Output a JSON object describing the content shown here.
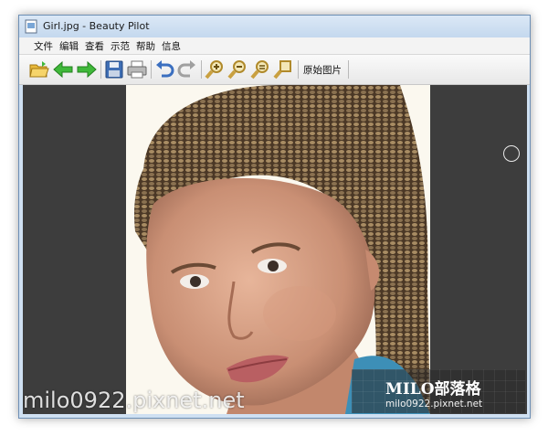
{
  "window": {
    "title": "Girl.jpg - Beauty Pilot"
  },
  "menu": {
    "items": [
      {
        "label": "文件"
      },
      {
        "label": "编辑"
      },
      {
        "label": "查看"
      },
      {
        "label": "示范"
      },
      {
        "label": "帮助"
      },
      {
        "label": "信息"
      }
    ]
  },
  "toolbar": {
    "buttons": [
      {
        "icon": "open-folder-icon"
      },
      {
        "icon": "back-arrow-icon"
      },
      {
        "icon": "forward-arrow-icon"
      },
      {
        "icon": "save-icon"
      },
      {
        "icon": "print-icon"
      },
      {
        "icon": "undo-icon"
      },
      {
        "icon": "redo-icon"
      },
      {
        "icon": "zoom-in-icon"
      },
      {
        "icon": "zoom-out-icon"
      },
      {
        "icon": "zoom-fit-icon"
      },
      {
        "icon": "zoom-actual-icon"
      }
    ],
    "original_image_label": "原始图片"
  },
  "colors": {
    "arrow_green": "#3fb83a",
    "canvas_bg": "#3d3d3d"
  },
  "watermark": {
    "left_text": "milo0922.pixnet.net",
    "brand": "MILO部落格",
    "url": "milo0922.pixnet.net"
  }
}
